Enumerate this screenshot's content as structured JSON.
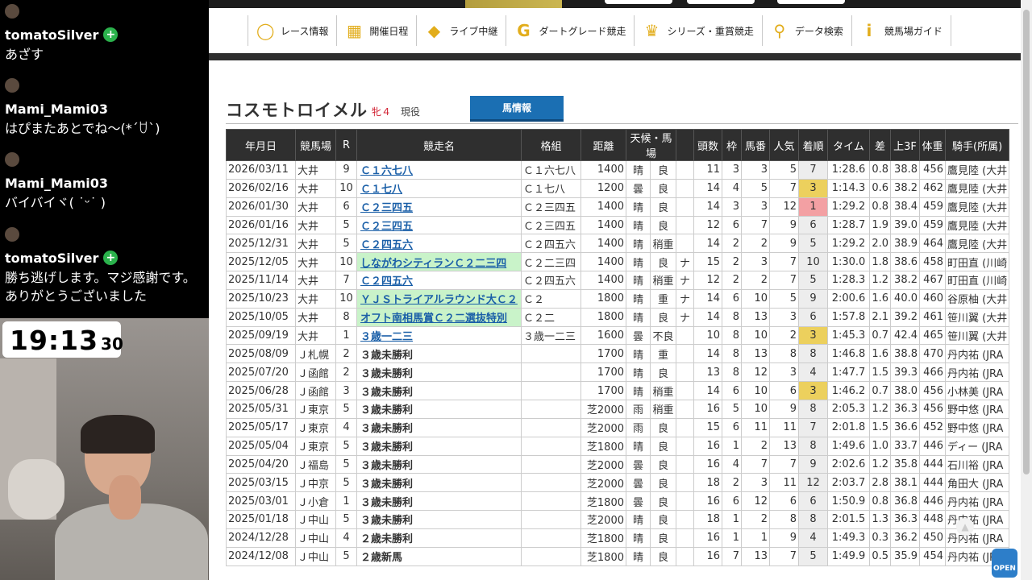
{
  "chat": [
    {
      "user": "tomatoSilver",
      "badge": true,
      "text": "あざす"
    },
    {
      "user": "Mami_Mami03",
      "badge": false,
      "text": "はぴまたあとでね〜(*´ꇴ`)"
    },
    {
      "user": "Mami_Mami03",
      "badge": false,
      "text": "バイバイヾ( ˙ᵕ˙ )"
    },
    {
      "user": "tomatoSilver",
      "badge": true,
      "text": "勝ち逃げします。マジ感謝です。ありがとうございました"
    }
  ],
  "clock": {
    "hm": "19:13",
    "sec": "30"
  },
  "nav": [
    {
      "icon": "race-info-icon",
      "glyph": "◯",
      "label": "レース情報"
    },
    {
      "icon": "calendar-icon",
      "glyph": "▦",
      "label": "開催日程"
    },
    {
      "icon": "live-icon",
      "glyph": "◆",
      "label": "ライブ中継"
    },
    {
      "icon": "dirt-grade-icon",
      "glyph": "G",
      "label": "ダートグレード競走"
    },
    {
      "icon": "trophy-icon",
      "glyph": "♛",
      "label": "シリーズ・重賞競走"
    },
    {
      "icon": "search-icon",
      "glyph": "⚲",
      "label": "データ検索"
    },
    {
      "icon": "info-icon",
      "glyph": "i",
      "label": "競馬場ガイド"
    }
  ],
  "horse": {
    "name": "コスモトロイメル",
    "sex_age": "牝４",
    "status": "現役",
    "info_button": "馬情報"
  },
  "table": {
    "headers": [
      "年月日",
      "競馬場",
      "R",
      "競走名",
      "格組",
      "距離",
      "天候・馬場",
      "",
      "頭数",
      "枠",
      "馬番",
      "人気",
      "着順",
      "タイム",
      "差",
      "上3F",
      "体重",
      "騎手(所属)"
    ],
    "rows": [
      [
        "2026/03/11",
        "大井",
        "9",
        "Ｃ１六七八",
        "Ｃ１六七八",
        "1400",
        "晴",
        "良",
        "",
        "11",
        "3",
        "3",
        "5",
        "7",
        "1:28.6",
        "0.8",
        "38.8",
        "456",
        "鷹見陸 (大井"
      ],
      [
        "2026/02/16",
        "大井",
        "10",
        "Ｃ１七八",
        "Ｃ１七八",
        "1200",
        "曇",
        "良",
        "",
        "14",
        "4",
        "5",
        "7",
        "3",
        "1:14.3",
        "0.6",
        "38.2",
        "462",
        "鷹見陸 (大井"
      ],
      [
        "2026/01/30",
        "大井",
        "6",
        "Ｃ２三四五",
        "Ｃ２三四五",
        "1400",
        "晴",
        "良",
        "",
        "14",
        "3",
        "3",
        "12",
        "1",
        "1:29.2",
        "0.8",
        "38.4",
        "459",
        "鷹見陸 (大井"
      ],
      [
        "2026/01/16",
        "大井",
        "5",
        "Ｃ２三四五",
        "Ｃ２三四五",
        "1400",
        "晴",
        "良",
        "",
        "12",
        "6",
        "7",
        "9",
        "6",
        "1:28.7",
        "1.9",
        "39.0",
        "459",
        "鷹見陸 (大井"
      ],
      [
        "2025/12/31",
        "大井",
        "5",
        "Ｃ２四五六",
        "Ｃ２四五六",
        "1400",
        "晴",
        "稍重",
        "",
        "14",
        "2",
        "2",
        "9",
        "5",
        "1:29.2",
        "2.0",
        "38.9",
        "464",
        "鷹見陸 (大井"
      ],
      [
        "2025/12/05",
        "大井",
        "10",
        "しながわシティランＣ２二三四",
        "Ｃ２二三四",
        "1400",
        "晴",
        "良",
        "ナ",
        "15",
        "2",
        "3",
        "7",
        "10",
        "1:30.0",
        "1.8",
        "38.6",
        "458",
        "町田直 (川崎"
      ],
      [
        "2025/11/14",
        "大井",
        "7",
        "Ｃ２四五六",
        "Ｃ２四五六",
        "1400",
        "晴",
        "稍重",
        "ナ",
        "12",
        "2",
        "2",
        "7",
        "5",
        "1:28.3",
        "1.2",
        "38.2",
        "467",
        "町田直 (川崎"
      ],
      [
        "2025/10/23",
        "大井",
        "10",
        "ＹＪＳトライアルラウンド大Ｃ２",
        "Ｃ２",
        "1800",
        "晴",
        "重",
        "ナ",
        "14",
        "6",
        "10",
        "5",
        "9",
        "2:00.6",
        "1.6",
        "40.0",
        "460",
        "谷原柚 (大井"
      ],
      [
        "2025/10/05",
        "大井",
        "8",
        "オフト南相馬賞Ｃ２二選抜特別",
        "Ｃ２二",
        "1800",
        "晴",
        "良",
        "ナ",
        "14",
        "8",
        "13",
        "3",
        "6",
        "1:57.8",
        "2.1",
        "39.2",
        "461",
        "笹川翼 (大井"
      ],
      [
        "2025/09/19",
        "大井",
        "1",
        "３歳一二三",
        "３歳一二三",
        "1600",
        "曇",
        "不良",
        "",
        "10",
        "8",
        "10",
        "2",
        "3",
        "1:45.3",
        "0.7",
        "42.4",
        "465",
        "笹川翼 (大井"
      ],
      [
        "2025/08/09",
        "Ｊ札幌",
        "2",
        "３歳未勝利",
        "",
        "1700",
        "晴",
        "重",
        "",
        "14",
        "8",
        "13",
        "8",
        "8",
        "1:46.8",
        "1.6",
        "38.8",
        "470",
        "丹内祐 (JRA"
      ],
      [
        "2025/07/20",
        "Ｊ函館",
        "2",
        "３歳未勝利",
        "",
        "1700",
        "晴",
        "良",
        "",
        "13",
        "8",
        "12",
        "3",
        "4",
        "1:47.7",
        "1.5",
        "39.3",
        "466",
        "丹内祐 (JRA"
      ],
      [
        "2025/06/28",
        "Ｊ函館",
        "3",
        "３歳未勝利",
        "",
        "1700",
        "晴",
        "稍重",
        "",
        "14",
        "6",
        "10",
        "6",
        "3",
        "1:46.2",
        "0.7",
        "38.0",
        "456",
        "小林美 (JRA"
      ],
      [
        "2025/05/31",
        "Ｊ東京",
        "5",
        "３歳未勝利",
        "",
        "芝2000",
        "雨",
        "稍重",
        "",
        "16",
        "5",
        "10",
        "9",
        "8",
        "2:05.3",
        "1.2",
        "36.3",
        "456",
        "野中悠 (JRA"
      ],
      [
        "2025/05/17",
        "Ｊ東京",
        "4",
        "３歳未勝利",
        "",
        "芝2000",
        "雨",
        "良",
        "",
        "15",
        "6",
        "11",
        "11",
        "7",
        "2:01.8",
        "1.5",
        "36.6",
        "452",
        "野中悠 (JRA"
      ],
      [
        "2025/05/04",
        "Ｊ東京",
        "5",
        "３歳未勝利",
        "",
        "芝1800",
        "晴",
        "良",
        "",
        "16",
        "1",
        "2",
        "13",
        "8",
        "1:49.6",
        "1.0",
        "33.7",
        "446",
        "ディー (JRA"
      ],
      [
        "2025/04/20",
        "Ｊ福島",
        "5",
        "３歳未勝利",
        "",
        "芝2000",
        "曇",
        "良",
        "",
        "16",
        "4",
        "7",
        "7",
        "9",
        "2:02.6",
        "1.2",
        "35.8",
        "444",
        "石川裕 (JRA"
      ],
      [
        "2025/03/15",
        "Ｊ中京",
        "5",
        "３歳未勝利",
        "",
        "芝2000",
        "曇",
        "良",
        "",
        "18",
        "2",
        "3",
        "11",
        "12",
        "2:03.7",
        "2.8",
        "38.1",
        "444",
        "角田大 (JRA"
      ],
      [
        "2025/03/01",
        "Ｊ小倉",
        "1",
        "３歳未勝利",
        "",
        "芝1800",
        "曇",
        "良",
        "",
        "16",
        "6",
        "12",
        "6",
        "6",
        "1:50.9",
        "0.8",
        "36.8",
        "446",
        "丹内祐 (JRA"
      ],
      [
        "2025/01/18",
        "Ｊ中山",
        "5",
        "３歳未勝利",
        "",
        "芝2000",
        "晴",
        "良",
        "",
        "18",
        "1",
        "2",
        "8",
        "8",
        "2:01.5",
        "1.3",
        "36.3",
        "448",
        "丹内祐 (JRA"
      ],
      [
        "2024/12/28",
        "Ｊ中山",
        "4",
        "２歳未勝利",
        "",
        "芝1800",
        "晴",
        "良",
        "",
        "16",
        "1",
        "1",
        "9",
        "4",
        "1:49.3",
        "0.3",
        "36.2",
        "450",
        "丹内祐 (JRA"
      ],
      [
        "2024/12/08",
        "Ｊ中山",
        "5",
        "２歳新馬",
        "",
        "芝1800",
        "晴",
        "良",
        "",
        "16",
        "7",
        "13",
        "7",
        "5",
        "1:49.9",
        "0.5",
        "35.9",
        "454",
        "丹内祐 (JRA"
      ]
    ]
  },
  "open_badge": "OPEN",
  "colors": {
    "gold": "#ecd05d",
    "red": "#f3a0a3",
    "green": "#c9f3c9",
    "link": "#1a5fa8",
    "button": "#1b6fb3"
  }
}
